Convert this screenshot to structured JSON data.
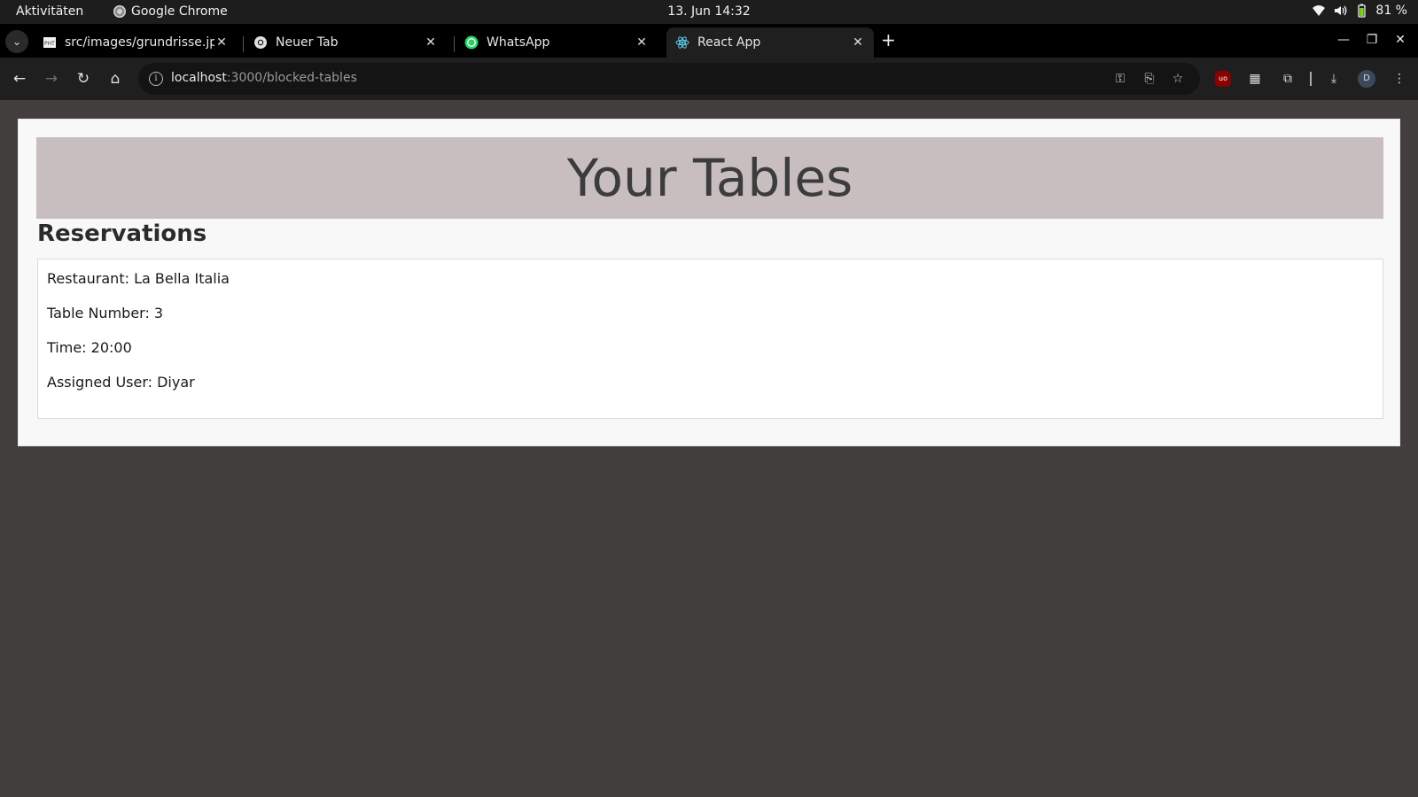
{
  "topbar": {
    "activities": "Aktivitäten",
    "app_name": "Google Chrome",
    "datetime": "13. Jun  14:32",
    "battery": "81 %",
    "icons": [
      "wifi-icon",
      "volume-icon",
      "battery-icon"
    ]
  },
  "tabs": [
    {
      "title": "src/images/grundrisse.jpg",
      "favicon": "image-file-icon",
      "active": false
    },
    {
      "title": "Neuer Tab",
      "favicon": "chrome-icon",
      "active": false
    },
    {
      "title": "WhatsApp",
      "favicon": "whatsapp-icon",
      "active": false
    },
    {
      "title": "React App",
      "favicon": "react-icon",
      "active": true
    }
  ],
  "toolbar": {
    "url_host": "localhost",
    "url_rest": ":3000/blocked-tables",
    "profile_initial": "D",
    "ublock_label": "uo"
  },
  "page": {
    "title": "Your Tables",
    "section_title": "Reservations",
    "reservation": {
      "restaurant": "Restaurant: La Bella Italia",
      "table": "Table Number: 3",
      "time": "Time: 20:00",
      "user": "Assigned User: Diyar"
    }
  },
  "colors": {
    "page_bg": "#423e3e",
    "header_band": "#c9bebf",
    "card_bg": "#ffffff"
  }
}
